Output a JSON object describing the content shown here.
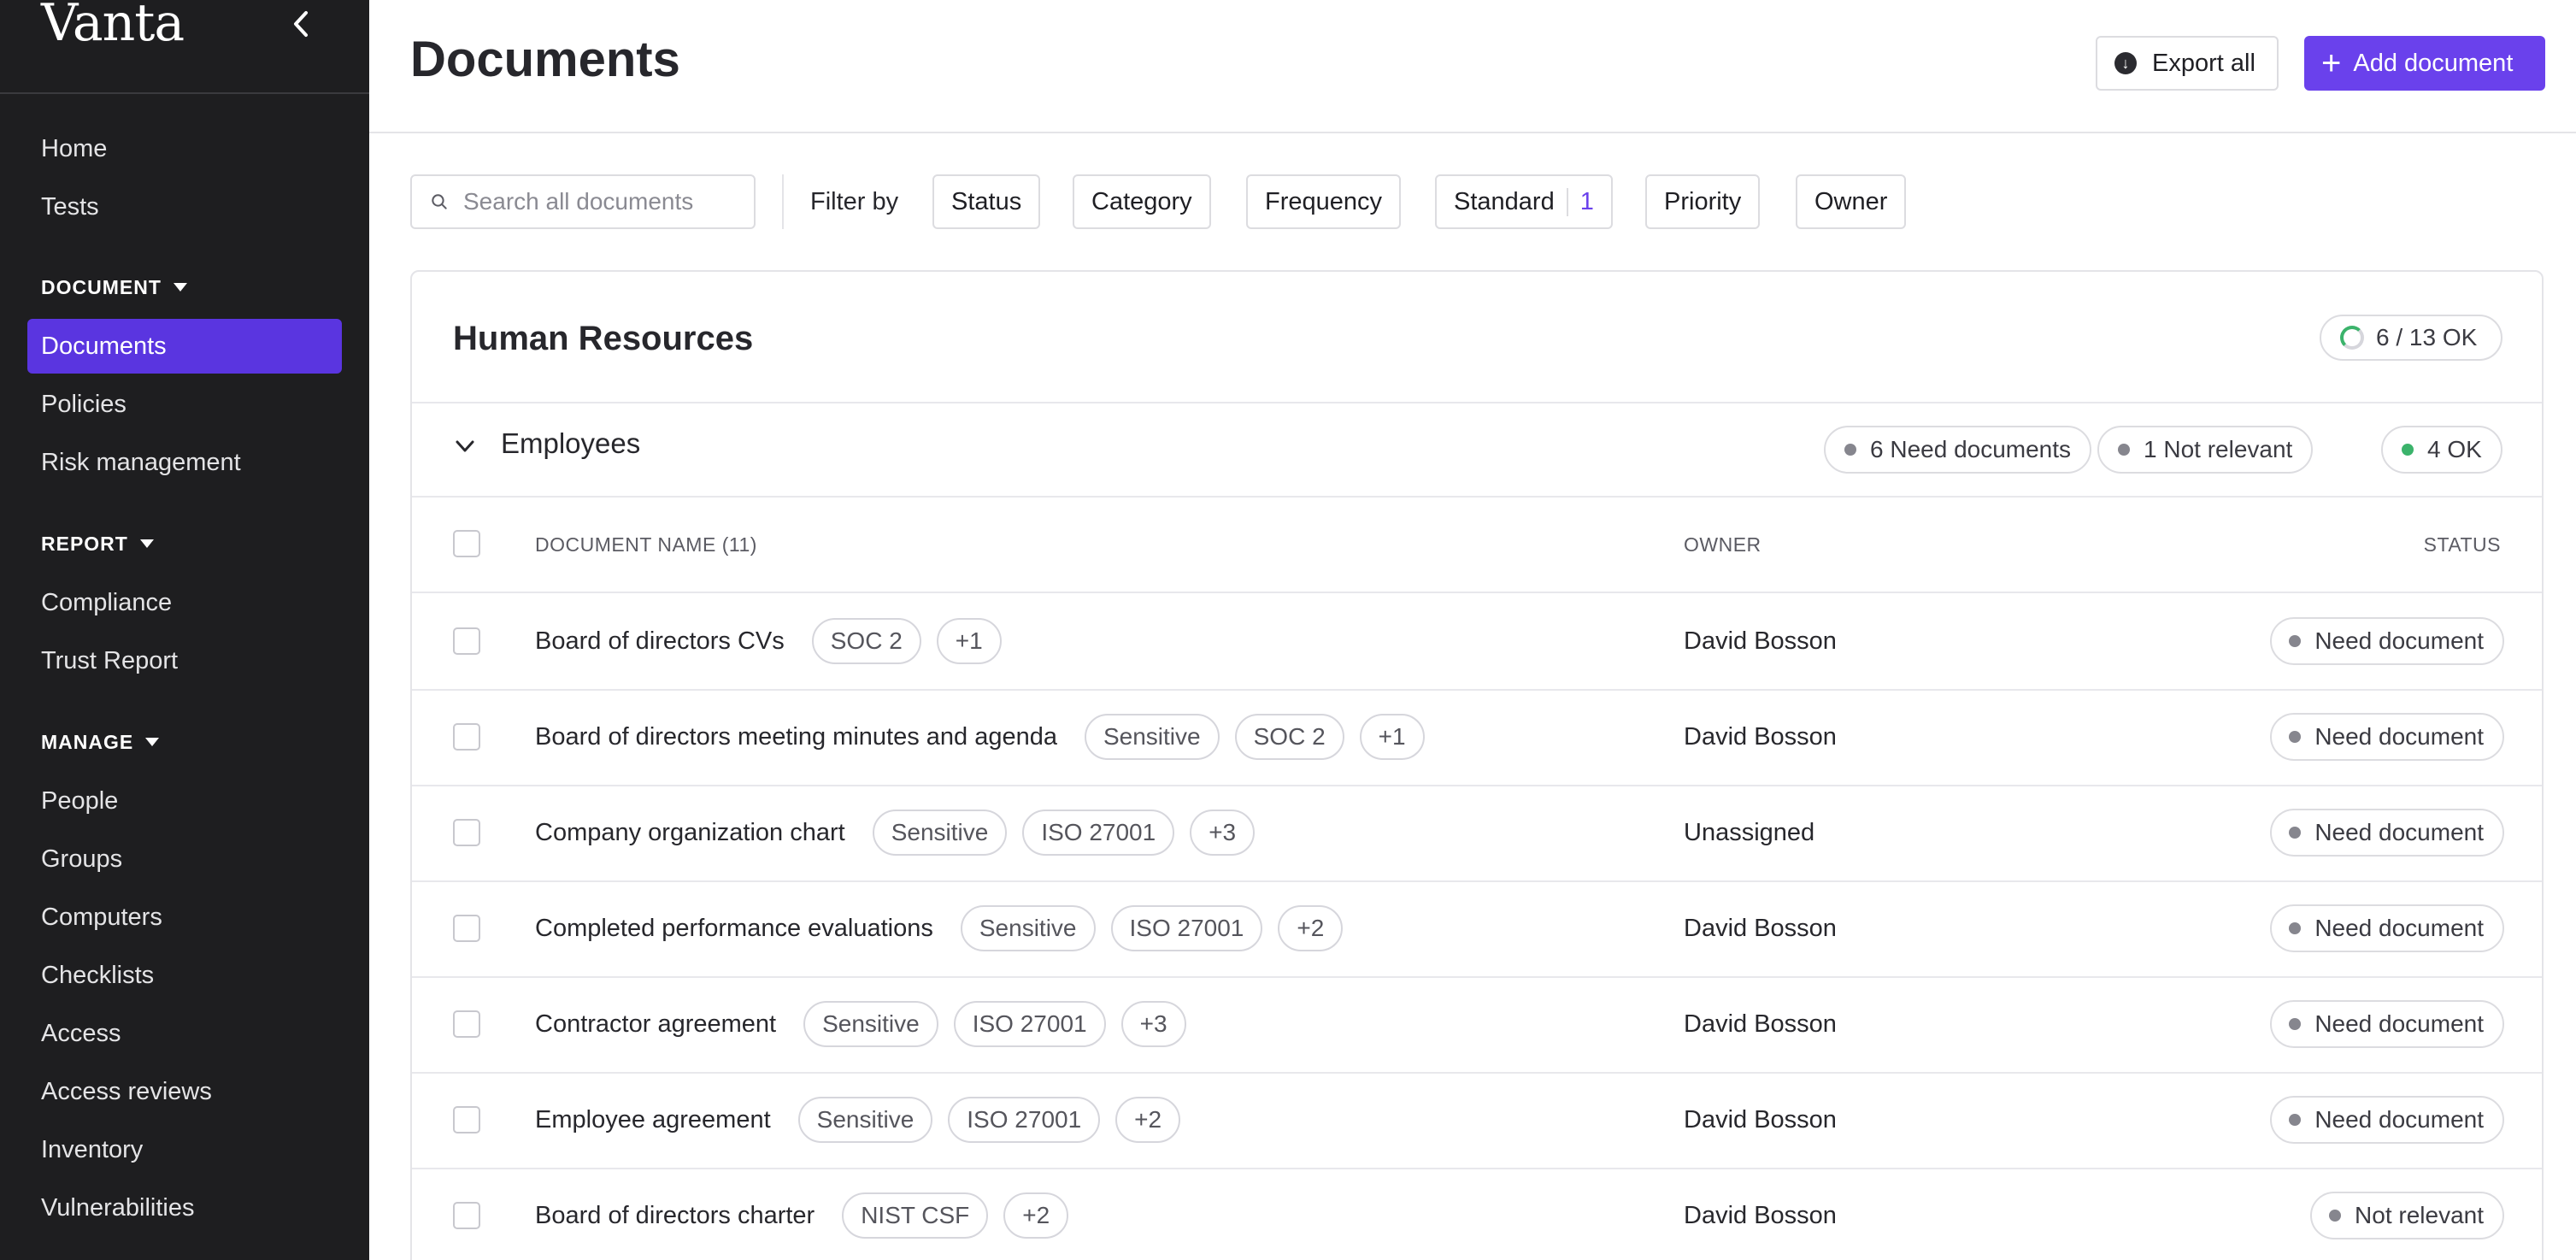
{
  "sidebar": {
    "logo": "Vanta",
    "items": [
      {
        "label": "Home"
      },
      {
        "label": "Tests"
      }
    ],
    "sections": [
      {
        "title": "DOCUMENT",
        "items": [
          {
            "label": "Documents",
            "active": true
          },
          {
            "label": "Policies"
          },
          {
            "label": "Risk management"
          }
        ]
      },
      {
        "title": "REPORT",
        "items": [
          {
            "label": "Compliance"
          },
          {
            "label": "Trust Report"
          }
        ]
      },
      {
        "title": "MANAGE",
        "items": [
          {
            "label": "People"
          },
          {
            "label": "Groups"
          },
          {
            "label": "Computers"
          },
          {
            "label": "Checklists"
          },
          {
            "label": "Access"
          },
          {
            "label": "Access reviews"
          },
          {
            "label": "Inventory"
          },
          {
            "label": "Vulnerabilities"
          }
        ]
      }
    ]
  },
  "header": {
    "title": "Documents",
    "export_label": "Export all",
    "add_label": "Add document"
  },
  "filters": {
    "search_placeholder": "Search all documents",
    "filter_by_label": "Filter by",
    "chips": [
      {
        "label": "Status"
      },
      {
        "label": "Category"
      },
      {
        "label": "Frequency"
      },
      {
        "label": "Standard",
        "count": "1"
      },
      {
        "label": "Priority"
      },
      {
        "label": "Owner"
      }
    ]
  },
  "card": {
    "title": "Human Resources",
    "progress": "6 / 13 OK",
    "group": {
      "title": "Employees",
      "summary": [
        {
          "label": "6 Need documents",
          "color": "#86868e"
        },
        {
          "label": "1 Not relevant",
          "color": "#86868e"
        },
        {
          "label": "4 OK",
          "color": "#3bb36b"
        }
      ]
    },
    "columns": {
      "name": "DOCUMENT NAME (11)",
      "owner": "OWNER",
      "status": "STATUS"
    },
    "rows": [
      {
        "name": "Board of directors CVs",
        "tags": [
          "SOC 2",
          "+1"
        ],
        "owner": "David Bosson",
        "status": "Need document"
      },
      {
        "name": "Board of directors meeting minutes and agenda",
        "tags": [
          "Sensitive",
          "SOC 2",
          "+1"
        ],
        "owner": "David Bosson",
        "status": "Need document"
      },
      {
        "name": "Company organization chart",
        "tags": [
          "Sensitive",
          "ISO 27001",
          "+3"
        ],
        "owner": "Unassigned",
        "status": "Need document"
      },
      {
        "name": "Completed performance evaluations",
        "tags": [
          "Sensitive",
          "ISO 27001",
          "+2"
        ],
        "owner": "David Bosson",
        "status": "Need document"
      },
      {
        "name": "Contractor agreement",
        "tags": [
          "Sensitive",
          "ISO 27001",
          "+3"
        ],
        "owner": "David Bosson",
        "status": "Need document"
      },
      {
        "name": "Employee agreement",
        "tags": [
          "Sensitive",
          "ISO 27001",
          "+2"
        ],
        "owner": "David Bosson",
        "status": "Need document"
      },
      {
        "name": "Board of directors charter",
        "tags": [
          "NIST CSF",
          "+2"
        ],
        "owner": "David Bosson",
        "status": "Not relevant"
      }
    ]
  }
}
